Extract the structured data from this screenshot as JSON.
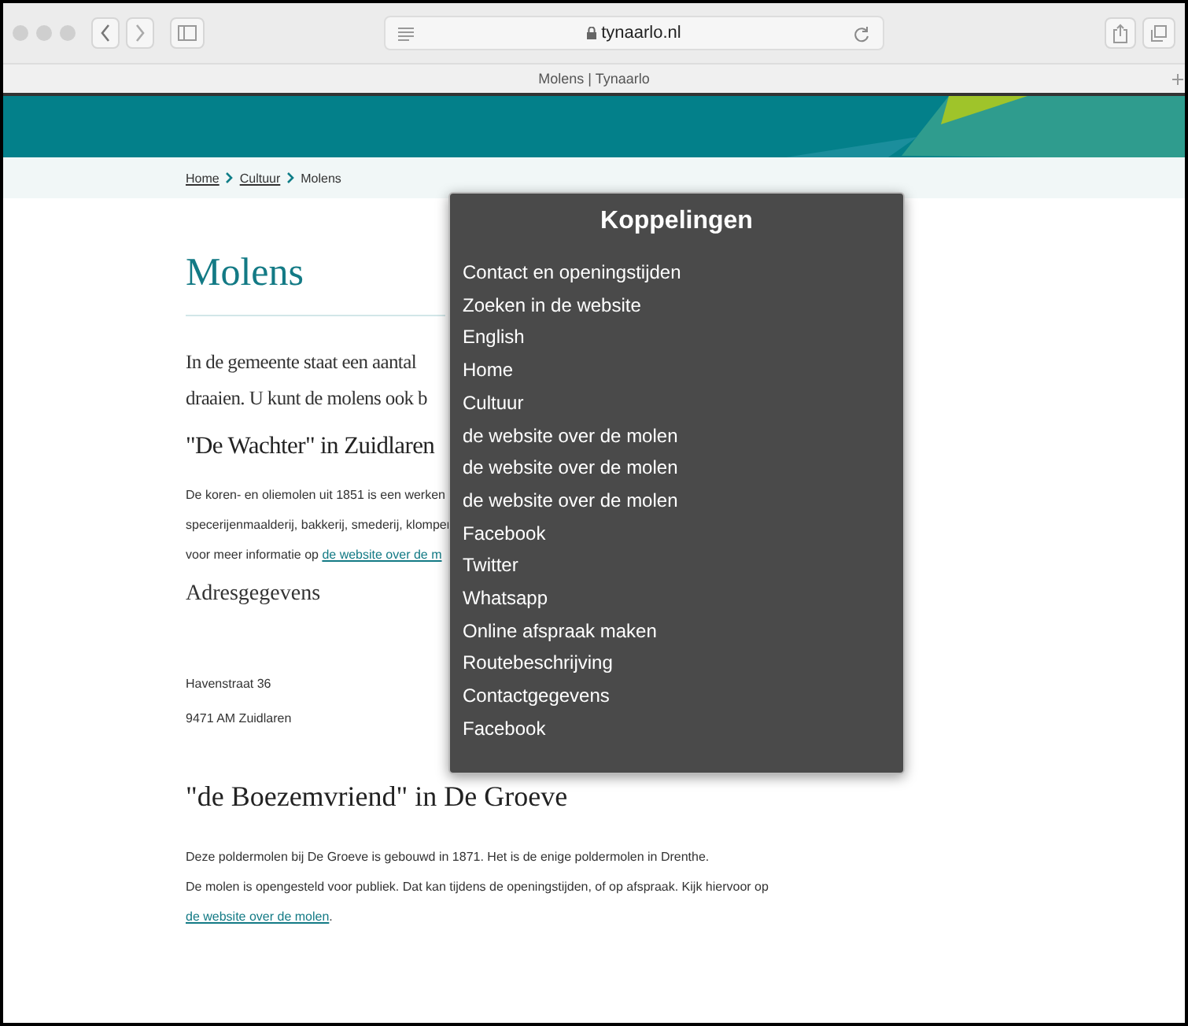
{
  "browser": {
    "address": "tynaarlo.nl",
    "tab_title": "Molens | Tynaarlo"
  },
  "breadcrumb": [
    {
      "label": "Home",
      "link": true
    },
    {
      "label": "Cultuur",
      "link": true
    },
    {
      "label": "Molens",
      "link": false
    }
  ],
  "page_title": "Molens",
  "intro_lines": [
    "In de gemeente staat een aantal",
    "draaien. U kunt de molens ook b"
  ],
  "sections": [
    {
      "heading": "\"De Wachter\" in Zuidlaren",
      "lines": [
        "De koren- en oliemolen uit 1851 is een werken",
        "specerijenmaalderij, bakkerij, smederij, klomper"
      ],
      "link_line": {
        "text": "voor meer informatie op",
        "link": "de website over de m"
      }
    },
    {
      "subheading": "Adresgegevens",
      "lines": [
        "Havenstraat 36",
        "9471 AM Zuidlaren"
      ]
    },
    {
      "heading": "\"de Boezemvriend\" in De Groeve",
      "lines": [
        "Deze poldermolen bij De Groeve is gebouwd in 1871. Het is de enige poldermolen in Drenthe."
      ],
      "link_line": {
        "text": "De molen is opengesteld voor publiek. Dat kan tijdens de openingstijden, of op afspraak. Kijk hiervoor op",
        "link": "de website over de molen",
        "after": "."
      }
    }
  ],
  "links_menu": {
    "title": "Koppelingen",
    "items": [
      "Contact en openingstijden",
      "Zoeken in de website",
      "English",
      "Home",
      "Cultuur",
      "de website over de molen",
      "de website over de molen",
      "de website over de molen",
      "Facebook",
      "Twitter",
      "Whatsapp",
      "Online afspraak maken",
      "Routebeschrijving",
      "Contactgegevens",
      "Facebook"
    ]
  }
}
